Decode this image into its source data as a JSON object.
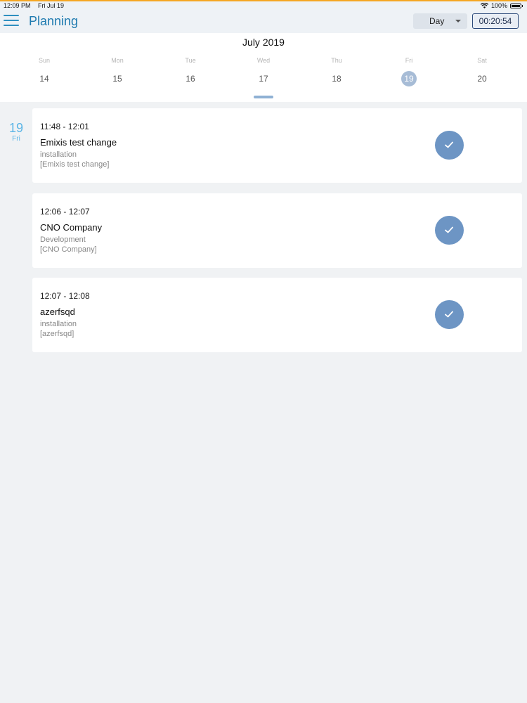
{
  "status_bar": {
    "time": "12:09 PM",
    "date": "Fri Jul 19",
    "battery": "100%",
    "wifi_icon": "wifi-icon"
  },
  "header": {
    "title": "Planning",
    "view_mode": "Day",
    "timer": "00:20:54"
  },
  "calendar": {
    "month": "July 2019",
    "days": [
      {
        "name": "Sun",
        "num": "14"
      },
      {
        "name": "Mon",
        "num": "15"
      },
      {
        "name": "Tue",
        "num": "16"
      },
      {
        "name": "Wed",
        "num": "17"
      },
      {
        "name": "Thu",
        "num": "18"
      },
      {
        "name": "Fri",
        "num": "19"
      },
      {
        "name": "Sat",
        "num": "20"
      }
    ],
    "selected_day": "19"
  },
  "agenda": {
    "date_num": "19",
    "date_dow": "Fri",
    "events": [
      {
        "time": "11:48 - 12:01",
        "title": "Emixis test change",
        "type": "installation",
        "ref": "[Emixis test change]"
      },
      {
        "time": "12:06 - 12:07",
        "title": "CNO Company",
        "type": "Development",
        "ref": "[CNO Company]"
      },
      {
        "time": "12:07 - 12:08",
        "title": "azerfsqd",
        "type": "installation",
        "ref": "[azerfsqd]"
      }
    ]
  },
  "colors": {
    "accent": "#1f7bb0",
    "check": "#6d95c4",
    "selected_day": "#a7bcd6",
    "date_label": "#5bb5e6"
  }
}
